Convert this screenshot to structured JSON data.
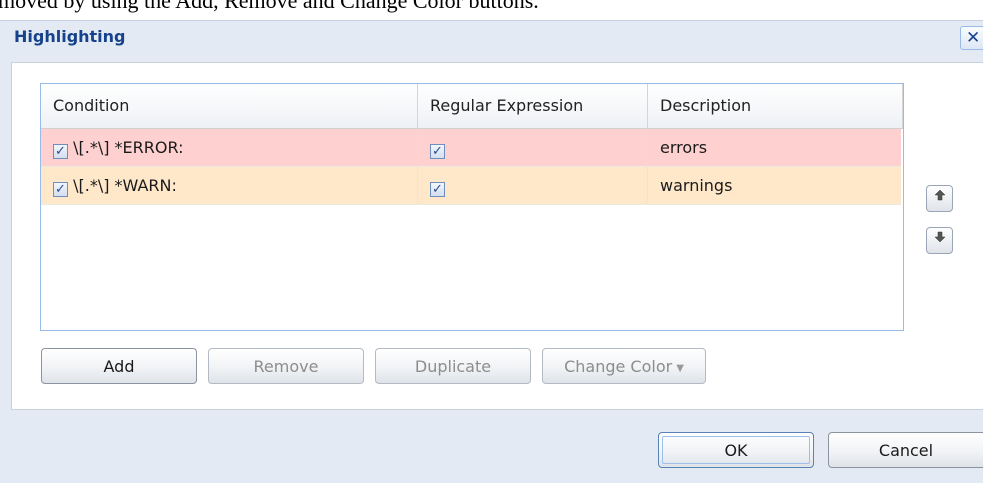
{
  "background_text": "moved by using the Add, Remove and Change Color buttons.",
  "dialog": {
    "title": "Highlighting",
    "close_icon": "close-icon",
    "close_glyph": "✕"
  },
  "grid": {
    "columns": [
      "Condition",
      "Regular Expression",
      "Description"
    ],
    "rows": [
      {
        "condition": "\\[.*\\] *ERROR:",
        "regex": true,
        "description": "errors",
        "color": "#ffd0d0"
      },
      {
        "condition": "\\[.*\\] *WARN:",
        "regex": true,
        "description": "warnings",
        "color": "#ffe8c9"
      }
    ]
  },
  "move_up_icon": "arrow-up-icon",
  "move_down_icon": "arrow-down-icon",
  "buttons": {
    "add": "Add",
    "remove": "Remove",
    "duplicate": "Duplicate",
    "change_color": "Change Color",
    "ok": "OK",
    "cancel": "Cancel"
  },
  "colors": {
    "title": "#15428b",
    "error_row": "#ffd0d0",
    "warn_row": "#ffe8c9",
    "dialog_bg": "#e3eaf3"
  }
}
